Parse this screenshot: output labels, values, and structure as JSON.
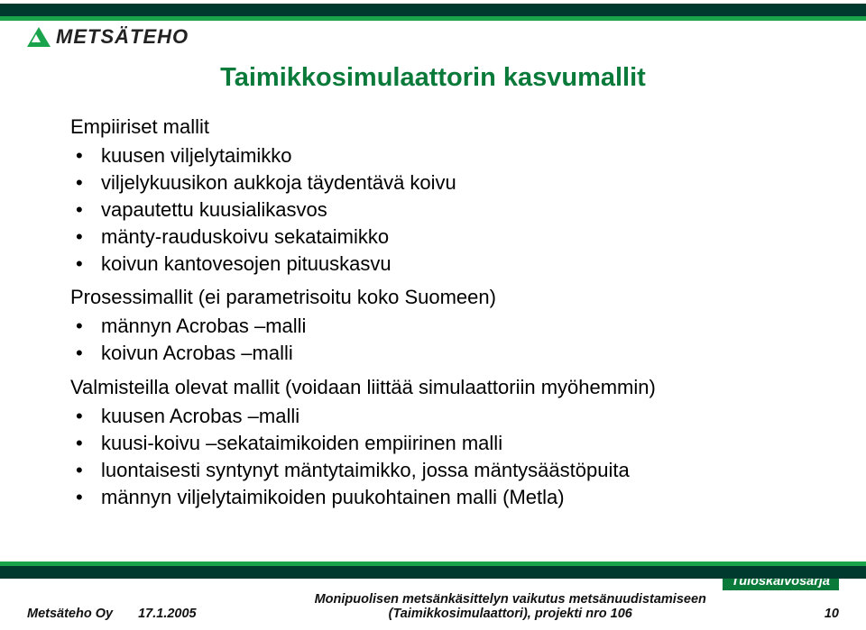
{
  "logo": {
    "text": "METSÄTEHO"
  },
  "title": "Taimikkosimulaattorin kasvumallit",
  "section1": {
    "heading": "Empiiriset mallit",
    "items": [
      "kuusen viljelytaimikko",
      "viljelykuusikon aukkoja täydentävä koivu",
      "vapautettu kuusialikasvos",
      "mänty-rauduskoivu sekataimikko",
      "koivun kantovesojen pituuskasvu"
    ]
  },
  "section2": {
    "heading": "Prosessimallit (ei parametrisoitu koko Suomeen)",
    "items": [
      "männyn Acrobas –malli",
      "koivun Acrobas –malli"
    ]
  },
  "section3": {
    "heading": "Valmisteilla olevat mallit (voidaan liittää simulaattoriin myöhemmin)",
    "items": [
      "kuusen Acrobas –malli",
      "kuusi-koivu –sekataimikoiden empiirinen malli",
      "luontaisesti syntynyt mäntytaimikko, jossa mäntysäästöpuita",
      "männyn viljelytaimikoiden puukohtainen malli (Metla)"
    ]
  },
  "footer": {
    "company": "Metsäteho Oy",
    "date": "17.1.2005",
    "center_line1": "Monipuolisen metsänkäsittelyn vaikutus metsänuudistamiseen",
    "center_line2": "(Taimikkosimulaattori), projekti nro 106",
    "badge": "Tuloskalvosarja",
    "page": "10"
  }
}
